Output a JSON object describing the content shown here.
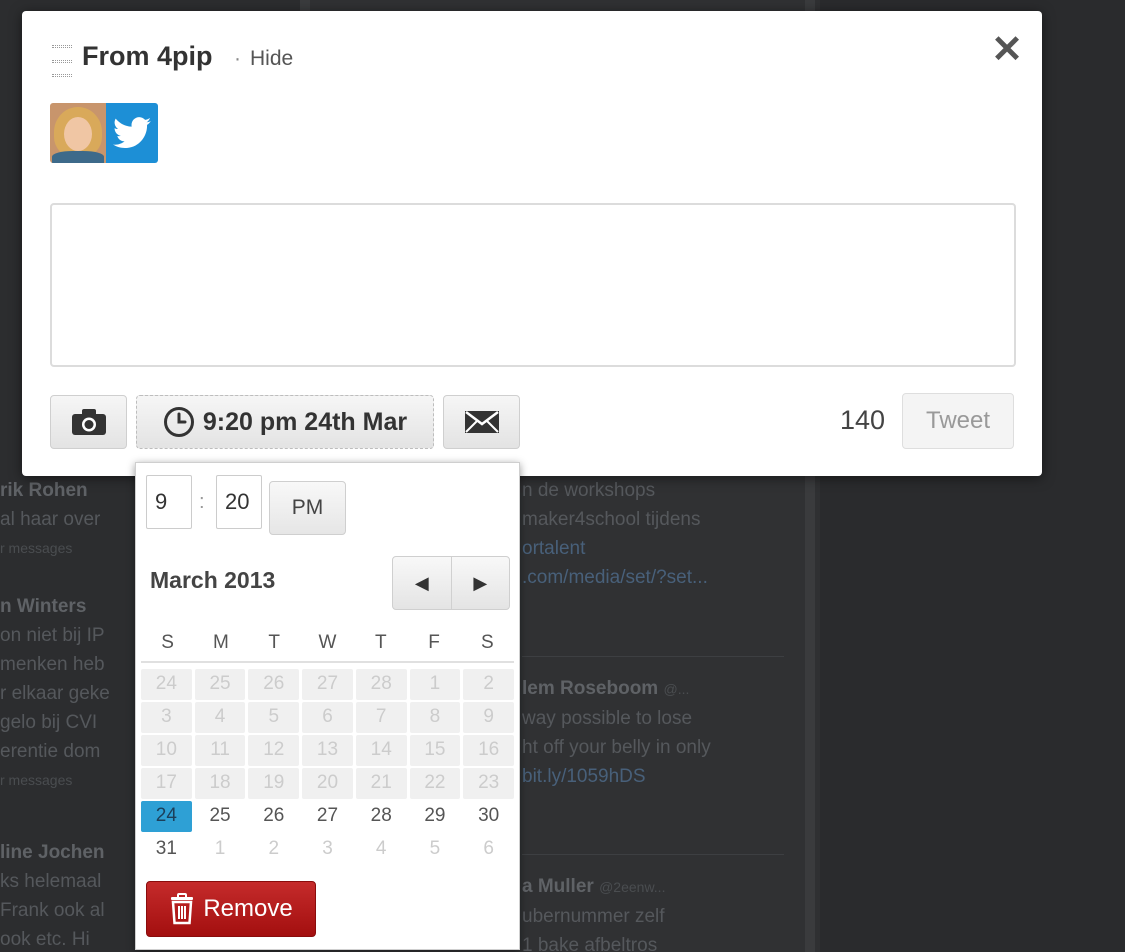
{
  "modal": {
    "title": "From 4pip",
    "hide_separator": "·",
    "hide_label": "Hide",
    "close_glyph": "✕",
    "accounts": [
      {
        "type": "avatar",
        "network": "twitter"
      }
    ],
    "compose": {
      "value": "",
      "placeholder": ""
    },
    "toolbar": {
      "camera_icon": "camera-icon",
      "schedule_label": "9:20 pm 24th Mar",
      "schedule_icon": "clock-icon",
      "email_icon": "envelope-icon"
    },
    "char_count": "140",
    "tweet_label": "Tweet"
  },
  "picker": {
    "hour": "9",
    "colon": ":",
    "minute": "20",
    "ampm": "PM",
    "month_label": "March 2013",
    "prev_glyph": "◀",
    "next_glyph": "▶",
    "weekdays": [
      "S",
      "M",
      "T",
      "W",
      "T",
      "F",
      "S"
    ],
    "days": [
      {
        "d": "24",
        "s": "disabled"
      },
      {
        "d": "25",
        "s": "disabled"
      },
      {
        "d": "26",
        "s": "disabled"
      },
      {
        "d": "27",
        "s": "disabled"
      },
      {
        "d": "28",
        "s": "disabled"
      },
      {
        "d": "1",
        "s": "disabled"
      },
      {
        "d": "2",
        "s": "disabled"
      },
      {
        "d": "3",
        "s": "disabled"
      },
      {
        "d": "4",
        "s": "disabled"
      },
      {
        "d": "5",
        "s": "disabled"
      },
      {
        "d": "6",
        "s": "disabled"
      },
      {
        "d": "7",
        "s": "disabled"
      },
      {
        "d": "8",
        "s": "disabled"
      },
      {
        "d": "9",
        "s": "disabled"
      },
      {
        "d": "10",
        "s": "disabled"
      },
      {
        "d": "11",
        "s": "disabled"
      },
      {
        "d": "12",
        "s": "disabled"
      },
      {
        "d": "13",
        "s": "disabled"
      },
      {
        "d": "14",
        "s": "disabled"
      },
      {
        "d": "15",
        "s": "disabled"
      },
      {
        "d": "16",
        "s": "disabled"
      },
      {
        "d": "17",
        "s": "disabled"
      },
      {
        "d": "18",
        "s": "disabled"
      },
      {
        "d": "19",
        "s": "disabled"
      },
      {
        "d": "20",
        "s": "disabled"
      },
      {
        "d": "21",
        "s": "disabled"
      },
      {
        "d": "22",
        "s": "disabled"
      },
      {
        "d": "23",
        "s": "disabled"
      },
      {
        "d": "24",
        "s": "selected"
      },
      {
        "d": "25",
        "s": "active"
      },
      {
        "d": "26",
        "s": "active"
      },
      {
        "d": "27",
        "s": "active"
      },
      {
        "d": "28",
        "s": "active"
      },
      {
        "d": "29",
        "s": "active"
      },
      {
        "d": "30",
        "s": "active"
      },
      {
        "d": "31",
        "s": "active"
      },
      {
        "d": "1",
        "s": "other"
      },
      {
        "d": "2",
        "s": "other"
      },
      {
        "d": "3",
        "s": "other"
      },
      {
        "d": "4",
        "s": "other"
      },
      {
        "d": "5",
        "s": "other"
      },
      {
        "d": "6",
        "s": "other"
      }
    ],
    "remove_label": "Remove"
  },
  "background": {
    "left_lines": [
      "rik Rohen",
      "al haar over",
      "r messages",
      "n Winters",
      "on niet bij IP",
      "menken heb",
      "r elkaar geke",
      "gelo bij CVI",
      "erentie dom",
      "r messages",
      "line Jochen",
      "ks helemaal",
      "Frank ook al",
      "ook etc. Hi"
    ],
    "mid_lines_a": [
      "n de workshops",
      "maker4school tijdens",
      "ortalent",
      ".com/media/set/?set..."
    ],
    "mid_name_b": "lem Roseboom",
    "mid_handle_b": "@...",
    "mid_lines_b": [
      "way possible to lose",
      "ht off your belly in only",
      "bit.ly/1059hDS"
    ],
    "mid_name_c": "a Muller",
    "mid_handle_c": "@2eenw...",
    "mid_lines_c": [
      "ubernummer zelf",
      "1 bake afbeltros"
    ]
  },
  "colors": {
    "selected_day": "#2ea0d5",
    "remove_button": "#b81c1c",
    "twitter_blue": "#1d8fd6",
    "backdrop": "#2f3032"
  }
}
